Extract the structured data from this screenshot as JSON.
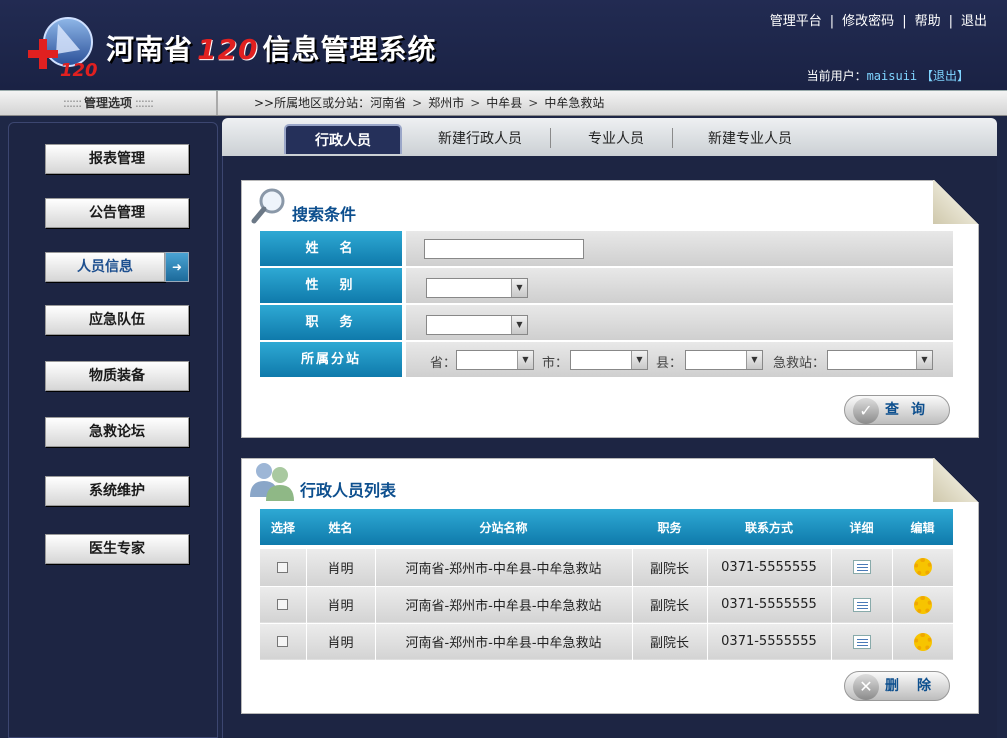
{
  "header": {
    "title_prefix": "河南省",
    "title_number": "120",
    "title_suffix": "信息管理系统",
    "top_links": [
      "管理平台",
      "修改密码",
      "帮助",
      "退出"
    ],
    "user_label": "当前用户：",
    "username": "maisuii",
    "logout": "【退出】"
  },
  "strip": {
    "menu_caption": "管理选项",
    "breadcrumb_prefix": ">>所属地区或分站：",
    "breadcrumb": [
      "河南省",
      "郑州市",
      "中牟县",
      "中牟急救站"
    ]
  },
  "sidebar": {
    "items": [
      "报表管理",
      "公告管理",
      "人员信息",
      "应急队伍",
      "物质装备",
      "急救论坛",
      "系统维护",
      "医生专家"
    ],
    "active": "人员信息"
  },
  "tabs": [
    "行政人员",
    "新建行政人员",
    "专业人员",
    "新建专业人员"
  ],
  "search": {
    "title": "搜索条件",
    "labels": [
      "姓　名",
      "性　别",
      "职　务",
      "所属分站"
    ],
    "name_value": "",
    "gender_value": "",
    "duty_value": "",
    "region_labels": [
      "省：",
      "市：",
      "县：",
      "急救站："
    ],
    "button": "查询"
  },
  "list": {
    "title": "行政人员列表",
    "columns": [
      "选择",
      "姓名",
      "分站名称",
      "职务",
      "联系方式",
      "详细",
      "编辑"
    ],
    "rows": [
      {
        "name": "肖明",
        "station": "河南省-郑州市-中牟县-中牟急救站",
        "duty": "副院长",
        "phone": "0371-5555555"
      },
      {
        "name": "肖明",
        "station": "河南省-郑州市-中牟县-中牟急救站",
        "duty": "副院长",
        "phone": "0371-5555555"
      },
      {
        "name": "肖明",
        "station": "河南省-郑州市-中牟县-中牟急救站",
        "duty": "副院长",
        "phone": "0371-5555555"
      }
    ],
    "delete_button": "删除"
  }
}
